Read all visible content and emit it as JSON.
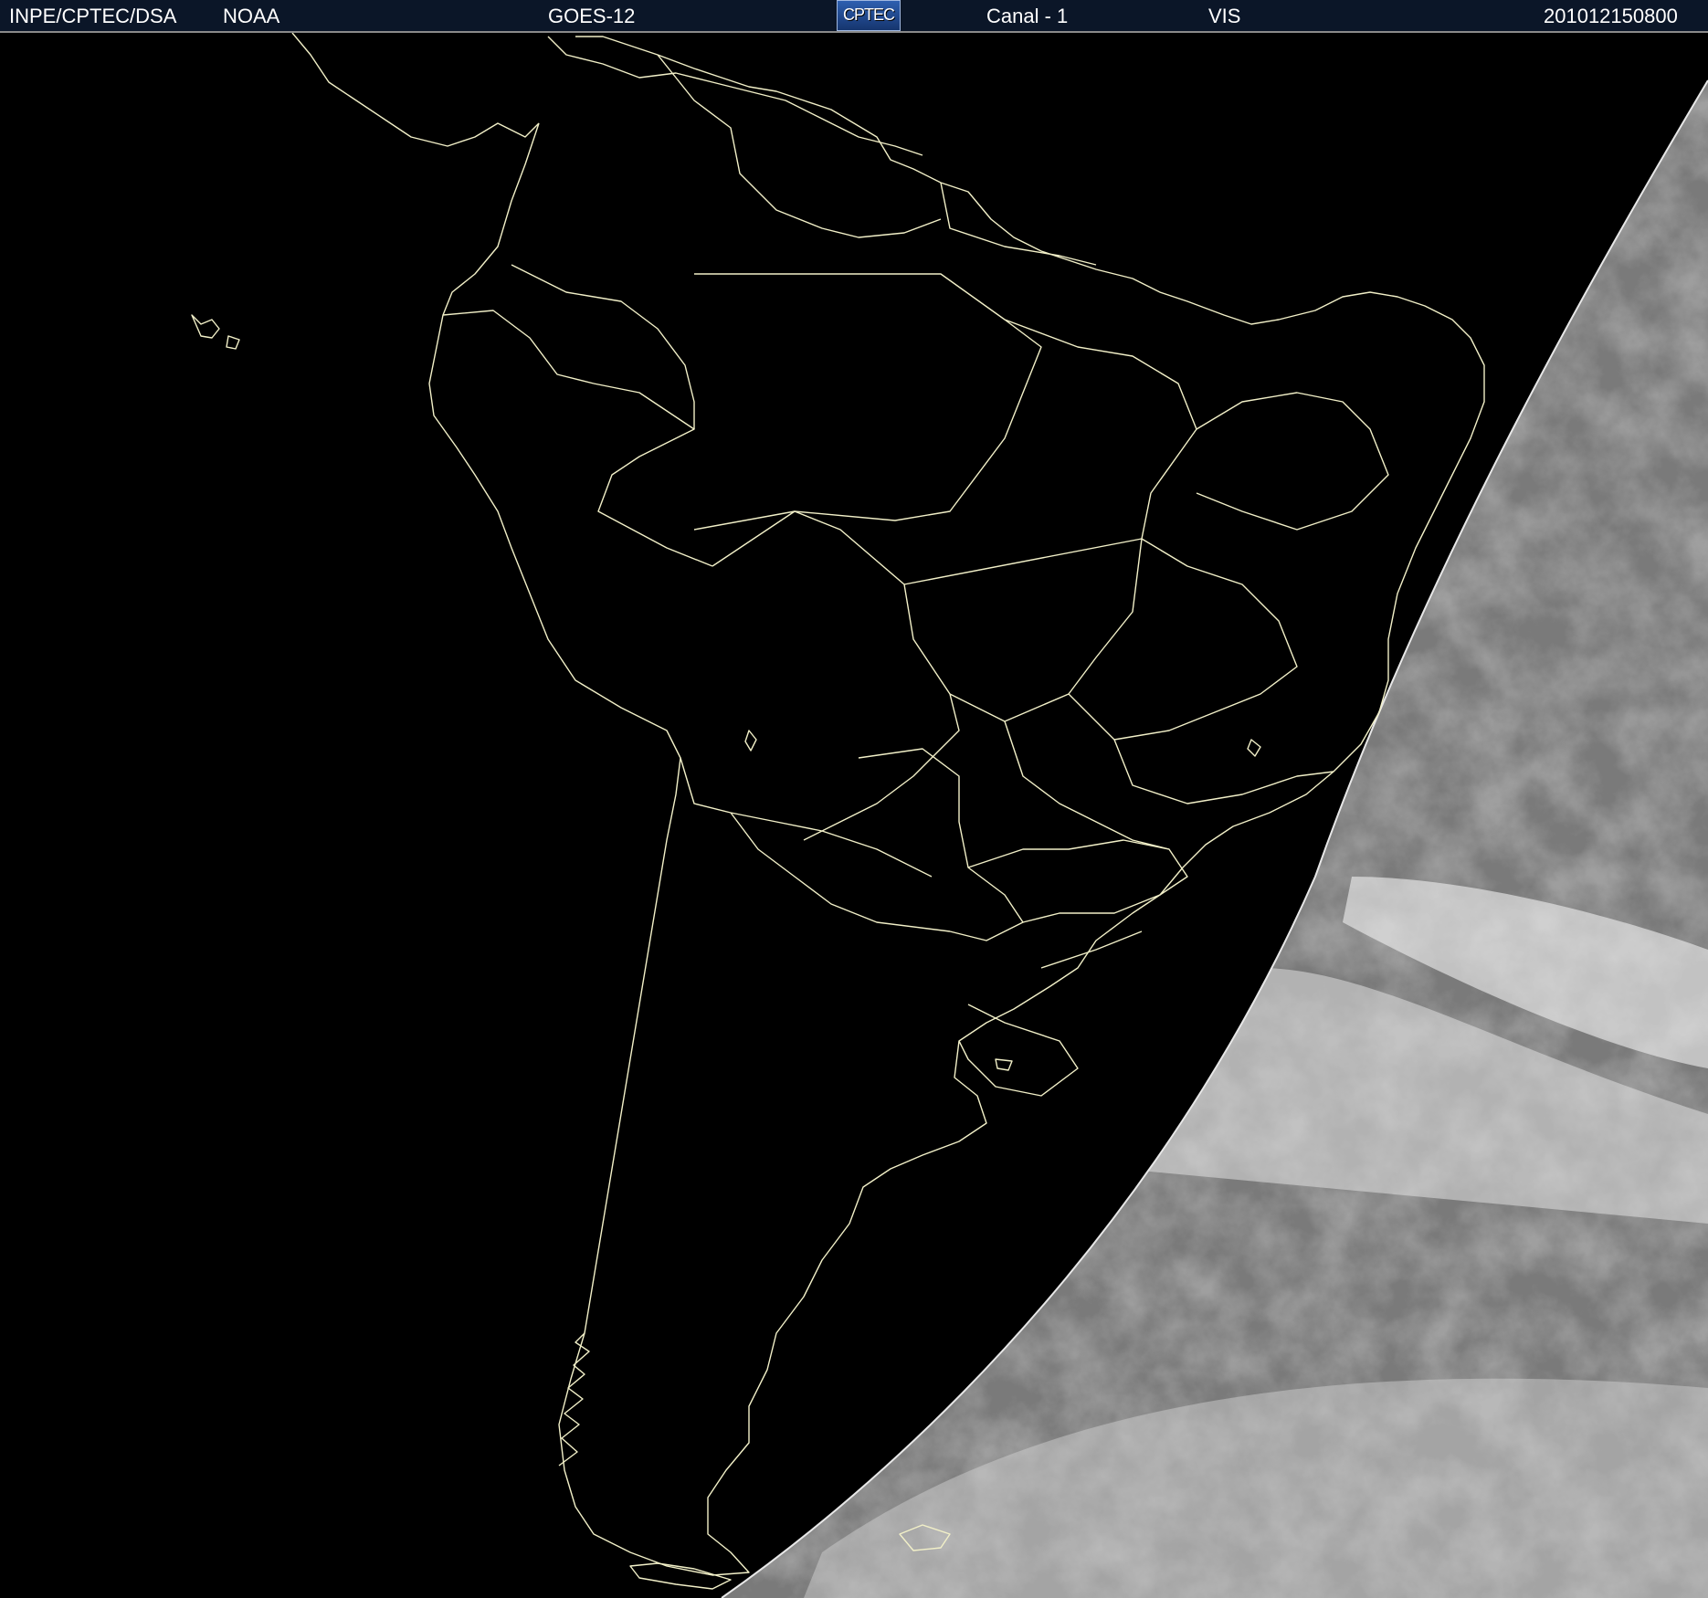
{
  "header": {
    "institution": "INPE/CPTEC/DSA",
    "agency": "NOAA",
    "satellite": "GOES-12",
    "logo_text": "CPTEC",
    "channel": "Canal - 1",
    "band": "VIS",
    "timestamp": "201012150800"
  },
  "colors": {
    "header_background": "#0b1628",
    "header_text": "#ffffff",
    "map_background": "#000000",
    "coastline": "#f2f0c8",
    "clouds": "#c9c9c9"
  },
  "map": {
    "region": "South America",
    "features": [
      "coastlines",
      "country-borders",
      "state-borders",
      "terminator",
      "cloud-cover"
    ],
    "terminator_side": "east"
  }
}
